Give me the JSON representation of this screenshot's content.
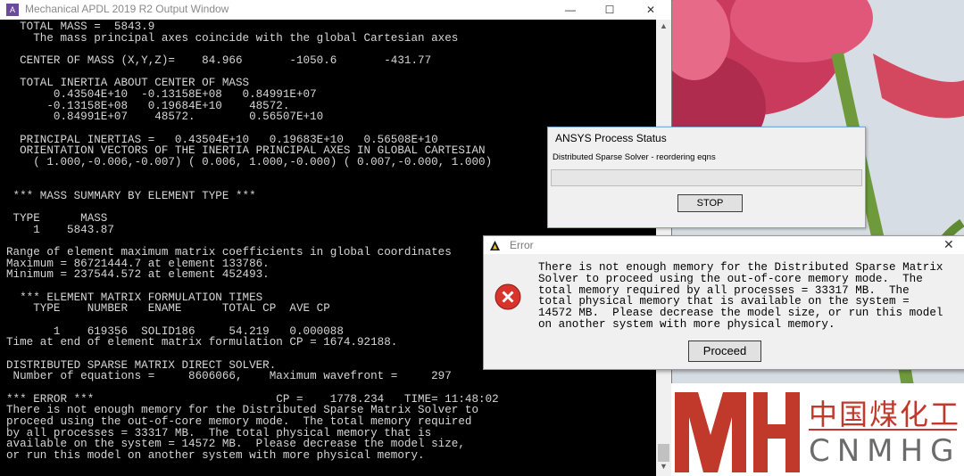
{
  "apdl_window": {
    "title": "Mechanical APDL 2019 R2 Output Window",
    "controls": {
      "minimize": "—",
      "maximize": "☐",
      "close": "✕"
    },
    "console_lines": [
      "  TOTAL MASS =  5843.9",
      "    The mass principal axes coincide with the global Cartesian axes",
      "",
      "  CENTER OF MASS (X,Y,Z)=    84.966       -1050.6       -431.77",
      "",
      "  TOTAL INERTIA ABOUT CENTER OF MASS",
      "       0.43504E+10  -0.13158E+08   0.84991E+07",
      "      -0.13158E+08   0.19684E+10    48572.",
      "       0.84991E+07    48572.        0.56507E+10",
      "",
      "  PRINCIPAL INERTIAS =   0.43504E+10   0.19683E+10   0.56508E+10",
      "  ORIENTATION VECTORS OF THE INERTIA PRINCIPAL AXES IN GLOBAL CARTESIAN",
      "    ( 1.000,-0.006,-0.007) ( 0.006, 1.000,-0.000) ( 0.007,-0.000, 1.000)",
      "",
      "",
      " *** MASS SUMMARY BY ELEMENT TYPE ***",
      "",
      " TYPE      MASS",
      "    1    5843.87",
      "",
      "Range of element maximum matrix coefficients in global coordinates",
      "Maximum = 86721444.7 at element 133786.",
      "Minimum = 237544.572 at element 452493.",
      "",
      "  *** ELEMENT MATRIX FORMULATION TIMES",
      "    TYPE    NUMBER   ENAME      TOTAL CP  AVE CP",
      "",
      "       1    619356  SOLID186     54.219   0.000088",
      "Time at end of element matrix formulation CP = 1674.92188.",
      "",
      "DISTRIBUTED SPARSE MATRIX DIRECT SOLVER.",
      " Number of equations =     8606066,    Maximum wavefront =     297",
      "",
      "*** ERROR ***                           CP =    1778.234   TIME= 11:48:02",
      "There is not enough memory for the Distributed Sparse Matrix Solver to",
      "proceed using the out-of-core memory mode.  The total memory required",
      "by all processes = 33317 MB.  The total physical memory that is",
      "available on the system = 14572 MB.  Please decrease the model size,",
      "or run this model on another system with more physical memory."
    ]
  },
  "status_dialog": {
    "title": "ANSYS Process Status",
    "message": "Distributed Sparse Solver - reordering eqns",
    "progress": 0,
    "stop_label": "STOP"
  },
  "error_dialog": {
    "title": "Error",
    "close": "✕",
    "message_lines": [
      "There is not enough memory for the Distributed Sparse Matrix",
      "Solver to proceed using the out-of-core memory mode.  The",
      "total memory required by all processes = 33317 MB.  The",
      "total physical memory that is available on the system =",
      "14572 MB.  Please decrease the model size, or run this model",
      "on another system with more physical memory."
    ],
    "proceed_label": "Proceed"
  },
  "logo": {
    "chinese": "中国煤化工",
    "english": "CNMHG"
  },
  "colors": {
    "console_bg": "#000000",
    "console_text": "#d6d6d6",
    "logo_red": "#c0392b",
    "error_red": "#d9342b"
  }
}
